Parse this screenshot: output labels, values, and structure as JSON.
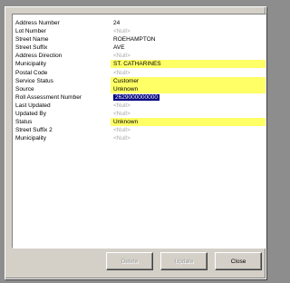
{
  "fields": [
    {
      "label": "Address Number",
      "value": "24",
      "style": "plain"
    },
    {
      "label": "Lot Number",
      "value": "<Null>",
      "style": "empty"
    },
    {
      "label": "Street Name",
      "value": "ROEHAMPTON",
      "style": "plain"
    },
    {
      "label": "Street Suffix",
      "value": "AVE",
      "style": "plain"
    },
    {
      "label": "Address Direction",
      "value": "<Null>",
      "style": "empty"
    },
    {
      "label": "Municipality",
      "value": "ST. CATHARINES",
      "style": "yellow"
    },
    {
      "label": "Postal Code",
      "value": "<Null>",
      "style": "empty"
    },
    {
      "label": "Service Status",
      "value": "Customer",
      "style": "yellow"
    },
    {
      "label": "Source",
      "value": "Unknown",
      "style": "yellow"
    },
    {
      "label": "Roll Assessment Number",
      "value": "2629000000000",
      "style": "selected"
    },
    {
      "label": "Last Updated",
      "value": "<Null>",
      "style": "empty"
    },
    {
      "label": "Updated By",
      "value": "<Null>",
      "style": "empty"
    },
    {
      "label": "Status",
      "value": "Unknown",
      "style": "yellow"
    },
    {
      "label": "Street Suffix 2",
      "value": "<Null>",
      "style": "empty"
    },
    {
      "label": "Municipality",
      "value": "<Null>",
      "style": "empty"
    }
  ],
  "buttons": {
    "first_label": "Delete",
    "second_label": "Update",
    "close_label": "Close"
  }
}
